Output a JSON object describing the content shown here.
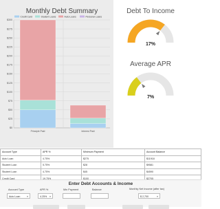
{
  "chart_data": {
    "type": "bar",
    "stacked": true,
    "title": "Monthly Debt Summary",
    "categories": [
      "Principle Paid",
      "Interest Paid"
    ],
    "series": [
      {
        "name": "Credit Card",
        "color": "#a8d0f0",
        "values": [
          50,
          12
        ]
      },
      {
        "name": "Student Loans",
        "color": "#a9e1d8",
        "values": [
          27,
          15
        ]
      },
      {
        "name": "Auto Loans",
        "color": "#e8a4a6",
        "values": [
          223,
          36
        ]
      },
      {
        "name": "Personal Loans",
        "color": "#c9b3e6",
        "values": [
          0,
          0
        ]
      }
    ],
    "yticks": [
      "$0",
      "$25",
      "$50",
      "$75",
      "$100",
      "$125",
      "$150",
      "$175",
      "$200",
      "$225",
      "$250",
      "$275",
      "$300"
    ],
    "ylim": [
      0,
      300
    ],
    "legend_position": "top",
    "grid": true
  },
  "gauges": [
    {
      "title": "Debt To Income",
      "value_label": "17%",
      "value": 17,
      "color": "#f5a623",
      "track": "#e6e6e6"
    },
    {
      "title": "Average APR",
      "value_label": "7%",
      "value": 7,
      "color": "#d9cf1c",
      "track": "#e6e6e6"
    }
  ],
  "table": {
    "headers": [
      "Account Type",
      "APR %",
      "Minimum Payment",
      "Account Balance"
    ],
    "rows": [
      [
        "Auto Loan",
        "4.75%",
        "$275",
        "$11918"
      ],
      [
        "Student Loan",
        "5.75%",
        "$28",
        "$9581"
      ],
      [
        "Student Loan",
        "4.75%",
        "$45",
        "$4590"
      ],
      [
        "Credit Card",
        "19.75%",
        "$100",
        "$2705"
      ]
    ]
  },
  "form": {
    "title": "Enter Debt Accounts & Income",
    "account_type_label": "Account Type",
    "account_type_value": "Auto Loan",
    "apr_label": "APR %",
    "apr_value": "4.25%",
    "min_payment_label": "Min Payment",
    "balance_label": "Balance",
    "income_label": "Monthly Net Income (after tax)",
    "income_value": "$ 2,700"
  }
}
